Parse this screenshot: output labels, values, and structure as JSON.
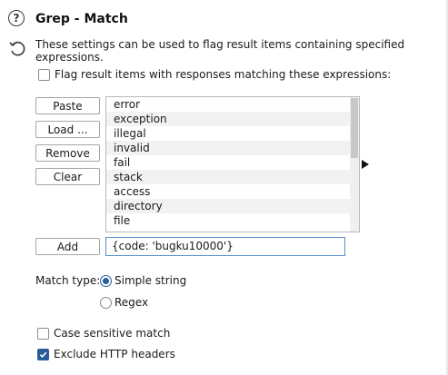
{
  "header": {
    "title": "Grep - Match",
    "description": "These settings can be used to flag result items containing specified expressions."
  },
  "flag_option": {
    "label": "Flag result items with responses matching these expressions:",
    "checked": false
  },
  "buttons": {
    "paste": "Paste",
    "load": "Load ...",
    "remove": "Remove",
    "clear": "Clear",
    "add": "Add"
  },
  "expressions": [
    "error",
    "exception",
    "illegal",
    "invalid",
    "fail",
    "stack",
    "access",
    "directory",
    "file"
  ],
  "add_input": {
    "value": "{code: 'bugku10000'}"
  },
  "match_type": {
    "label": "Match type:",
    "options": [
      "Simple string",
      "Regex"
    ],
    "selected": "Simple string"
  },
  "case_sensitive": {
    "label": "Case sensitive match",
    "checked": false
  },
  "exclude_headers": {
    "label": "Exclude HTTP headers",
    "checked": true
  },
  "colors": {
    "accent": "#2a5b9a",
    "input_border": "#5b8ed0",
    "alt_row": "#f2f2f2"
  },
  "icons": [
    "help-icon",
    "reset-icon",
    "expand-arrow-icon",
    "checkmark-icon"
  ]
}
